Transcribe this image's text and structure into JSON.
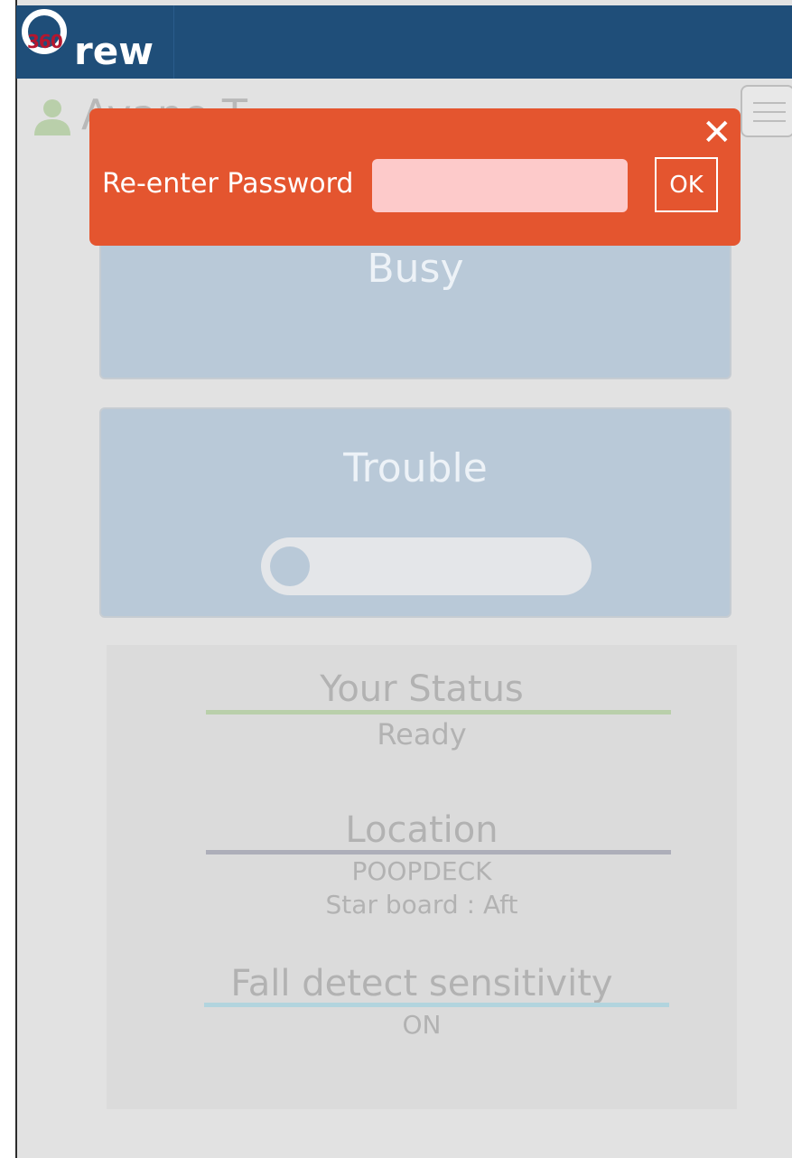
{
  "app": {
    "logo_number": "360",
    "logo_word": "rew",
    "user_name": "Ayane.T"
  },
  "cards": {
    "busy": {
      "label": "Busy"
    },
    "trouble": {
      "label": "Trouble",
      "toggle_on": false
    }
  },
  "status_panel": {
    "status_heading": "Your Status",
    "status_value": "Ready",
    "location_heading": "Location",
    "location_value": "POOPDECK",
    "location_detail": "Star board : Aft",
    "fall_heading": "Fall detect sensitivity",
    "fall_value": "ON"
  },
  "dialog": {
    "close_symbol": "✕",
    "label": "Re-enter Password",
    "input_value": "",
    "ok_label": "OK"
  },
  "colors": {
    "header": "#1f4e79",
    "dialog": "#e4552f",
    "input": "#fdcaca",
    "card": "#b9c9d8",
    "status_rule": "#b9cfaa",
    "location_rule": "#adaeb9",
    "fall_rule": "#b2d4de"
  },
  "icons": [
    "user-icon",
    "menu-icon",
    "close-icon"
  ]
}
